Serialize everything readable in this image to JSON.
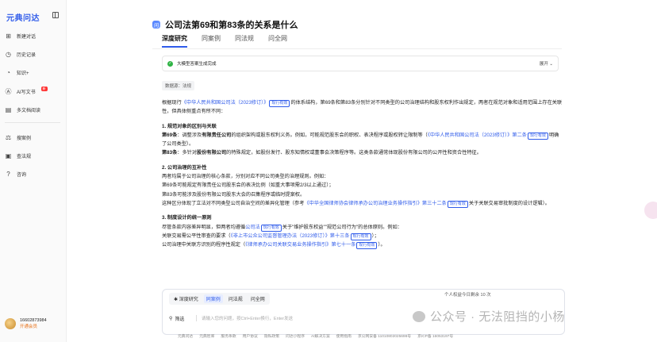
{
  "sidebar": {
    "brand": "元典问达",
    "items": [
      {
        "icon": "plus-square-icon",
        "label": "新建对话"
      },
      {
        "icon": "history-icon",
        "label": "历史记录"
      },
      {
        "icon": "lightbulb-icon",
        "label": "知识+"
      },
      {
        "icon": "ai-doc-icon",
        "label": "AI写文书",
        "tag": "新"
      },
      {
        "icon": "documents-icon",
        "label": "多文档阅读"
      },
      {
        "icon": "search-case-icon",
        "label": "搜案例"
      },
      {
        "icon": "search-law-icon",
        "label": "查法规"
      },
      {
        "icon": "question-icon",
        "label": "咨询"
      }
    ],
    "user": {
      "phone": "16602873984",
      "vip": "开通会员"
    }
  },
  "question": {
    "title": "公司法第69和第83条的关系是什么"
  },
  "tabs": [
    "深度研究",
    "同案例",
    "同法规",
    "问全网"
  ],
  "status": {
    "text": "大模型答案生成完成",
    "expand": "展开"
  },
  "source": "数据源：法规",
  "answer": {
    "intro_a": "根据现行",
    "law_link1": "《中华人民共和国公司法（2023修订）》",
    "badge": "现行有效",
    "intro_b": "的体系结构，第69条和第83条分别针对不同类型的公司治理结构和股东权利作出规定，两者在规范对象和适用范围上存在关联性，但具体侧重点有所不同：",
    "s1_title": "1. 规范对象的区别与关联",
    "s1_p1_a": "第69条",
    "s1_p1_b": "：调整涉及",
    "s1_p1_c": "有限责任公司",
    "s1_p1_d": "的组织架构或股东权利义务。例如，可能规范股东会的职权、表决程序或股权转让限制等（",
    "s1_p1_e": "第二条",
    "s1_p1_f": "明确了公司类型）。",
    "s1_p2_a": "第83条",
    "s1_p2_b": "：多针对",
    "s1_p2_c": "股份有限公司",
    "s1_p2_d": "的特殊规定，如股份发行、股东知情权或董事会决策程序等。这类条款通常体现股份有限公司的公开性和资合性特征。",
    "s2_title": "2. 公司治理的互补性",
    "s2_l1": "两者均属于公司治理的核心条款，分别对应不同公司类型的治理规则。例如：",
    "s2_l2": "第69条可能规定有限责任公司股东会的表决比例（如重大事项需2/3以上通过）；",
    "s2_l3": "第83条可能涉及股份有限公司股东大会的召集程序或临时提案权。",
    "s2_l4_a": "这种区分体现了立法对不同类型公司自治空间的差异化管理（参考",
    "s2_link": "《中华全国律师协会律师承办公司治理业务操作指引》第三十二条",
    "s2_l4_b": "关于关联交易审批制度的设计逻辑）。",
    "s3_title": "3. 制度设计的统一原则",
    "s3_l1_a": "尽管条款内容差异明显，但两者均遵循",
    "s3_link1": "公司法",
    "s3_l1_b": "关于\"维护股东权益\"\"规范公司行为\"的总体原则。例如：",
    "s3_l2_a": "关联交易需公平性审查的要求（",
    "s3_link2": "《非上市公众公司监督管理办法（2023修订）》第十三条",
    "s3_l2_b": "）；",
    "s3_l3_a": "公司治理中关联方识别的程序性规定（",
    "s3_link3": "《律师承办公司关联交易业务操作指引》第七十一条",
    "s3_l3_b": "）。"
  },
  "tokens": "个人权益今日剩余 10 次",
  "input": {
    "tabs": [
      "深度研究",
      "同案例",
      "问法规",
      "问全网"
    ],
    "active_tab": 1,
    "filter": "筛选",
    "placeholder": "请输入您的问题，按Ctrl+Enter换行，Enter发送"
  },
  "footer": [
    "元典问达",
    "元典智库",
    "服务条款",
    "用户协议",
    "隐私政策",
    "问达小程序",
    "AI解决方案",
    "使用指南",
    "京公网安备 11010802025698号",
    "京ICP备 16053197号"
  ],
  "watermark": "公众号 · 无法阻挡的小杨"
}
